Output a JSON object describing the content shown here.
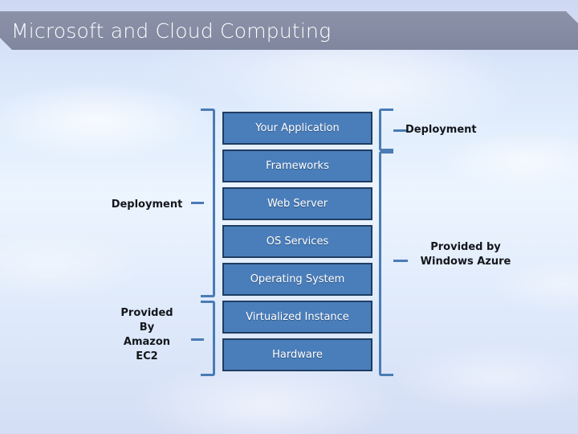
{
  "slide": {
    "title": "Microsoft and Cloud Computing",
    "background_description": "sky-with-clouds",
    "colors": {
      "banner": "#868da4",
      "box_fill": "#4a7ebb",
      "box_border": "#1f3d63",
      "bracket": "#4a7cb5",
      "caption_text": "#14161c",
      "title_text": "#ffffff"
    }
  },
  "diagram": {
    "type": "cloud-service-stack",
    "layers": [
      {
        "label": "Your Application"
      },
      {
        "label": "Frameworks"
      },
      {
        "label": "Web Server"
      },
      {
        "label": "OS Services"
      },
      {
        "label": "Operating System"
      },
      {
        "label": "Virtualized Instance"
      },
      {
        "label": "Hardware"
      }
    ],
    "left_captions": [
      {
        "label": "Deployment",
        "spans_layers": "Your Application through Operating System"
      },
      {
        "label": "Provided\nBy\nAmazon\nEC2",
        "spans_layers": "Virtualized Instance through Hardware"
      }
    ],
    "right_captions": [
      {
        "label": "Deployment",
        "spans_layers": "Your Application"
      },
      {
        "label": "Provided by\nWindows Azure",
        "spans_layers": "Frameworks through Hardware"
      }
    ]
  }
}
